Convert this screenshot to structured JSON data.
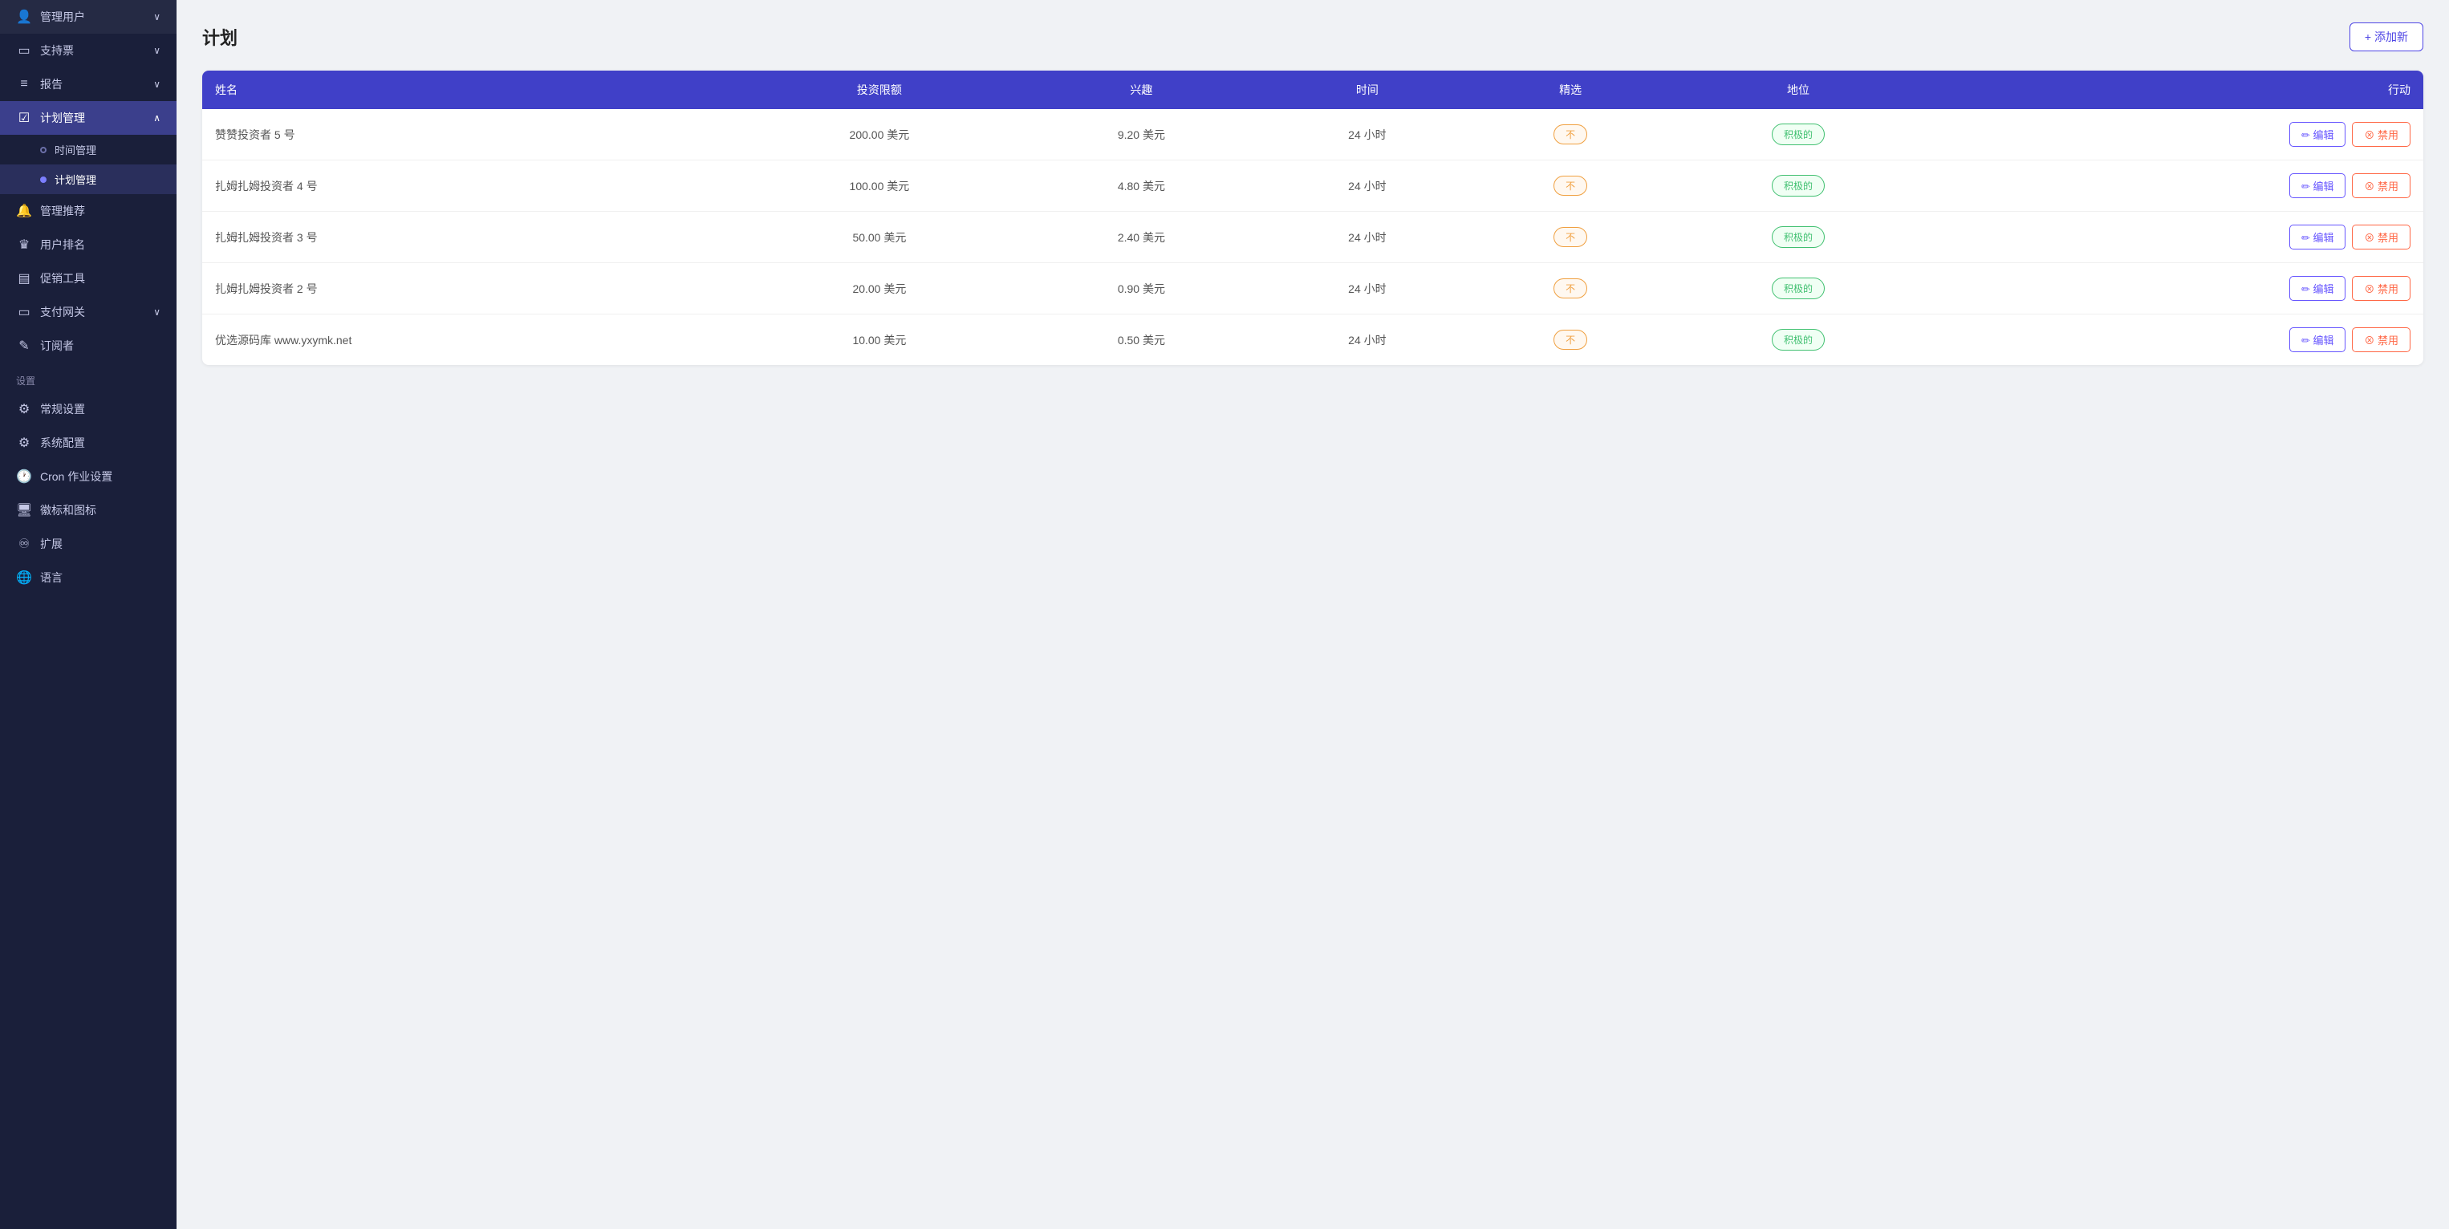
{
  "sidebar": {
    "items": [
      {
        "id": "manage-users",
        "label": "管理用户",
        "icon": "👤",
        "hasArrow": true,
        "active": false
      },
      {
        "id": "support-tickets",
        "label": "支持票",
        "icon": "🎫",
        "hasArrow": true,
        "active": false
      },
      {
        "id": "reports",
        "label": "报告",
        "icon": "📊",
        "hasArrow": true,
        "active": false
      },
      {
        "id": "plan-management",
        "label": "计划管理",
        "icon": "📋",
        "hasArrow": true,
        "active": true,
        "subItems": [
          {
            "id": "time-management",
            "label": "时间管理",
            "active": false
          },
          {
            "id": "plan-management-sub",
            "label": "计划管理",
            "active": true
          }
        ]
      },
      {
        "id": "manage-referrals",
        "label": "管理推荐",
        "icon": "🔔",
        "hasArrow": false,
        "active": false
      },
      {
        "id": "user-ranking",
        "label": "用户排名",
        "icon": "🏅",
        "hasArrow": false,
        "active": false
      },
      {
        "id": "promo-tools",
        "label": "促销工具",
        "icon": "🛍",
        "hasArrow": false,
        "active": false
      },
      {
        "id": "payment-gateway",
        "label": "支付网关",
        "icon": "💳",
        "hasArrow": true,
        "active": false
      },
      {
        "id": "subscribers",
        "label": "订阅者",
        "icon": "📝",
        "hasArrow": false,
        "active": false
      }
    ],
    "settings_label": "设置",
    "settings_items": [
      {
        "id": "general-settings",
        "label": "常规设置",
        "icon": "⚙️"
      },
      {
        "id": "system-config",
        "label": "系统配置",
        "icon": "🔧"
      },
      {
        "id": "cron-settings",
        "label": "Cron 作业设置",
        "icon": "🕐"
      },
      {
        "id": "logo-icons",
        "label": "徽标和图标",
        "icon": "🖥"
      },
      {
        "id": "extensions",
        "label": "扩展",
        "icon": "🔗"
      },
      {
        "id": "language",
        "label": "语言",
        "icon": "🌐"
      }
    ]
  },
  "page": {
    "title": "计划",
    "add_button": "+ 添加新"
  },
  "table": {
    "headers": [
      {
        "id": "name",
        "label": "姓名"
      },
      {
        "id": "investment-limit",
        "label": "投资限额"
      },
      {
        "id": "interest",
        "label": "兴趣"
      },
      {
        "id": "time",
        "label": "时间"
      },
      {
        "id": "featured",
        "label": "精选"
      },
      {
        "id": "status",
        "label": "地位"
      },
      {
        "id": "actions",
        "label": "行动"
      }
    ],
    "rows": [
      {
        "id": 1,
        "name": "赞赞投资者 5 号",
        "investment_limit": "200.00 美元",
        "interest": "9.20 美元",
        "time": "24 小时",
        "featured": "不",
        "status": "积极的",
        "edit_label": "编辑",
        "disable_label": "禁用"
      },
      {
        "id": 2,
        "name": "扎姆扎姆投资者 4 号",
        "investment_limit": "100.00 美元",
        "interest": "4.80 美元",
        "time": "24 小时",
        "featured": "不",
        "status": "积极的",
        "edit_label": "编辑",
        "disable_label": "禁用"
      },
      {
        "id": 3,
        "name": "扎姆扎姆投资者 3 号",
        "investment_limit": "50.00 美元",
        "interest": "2.40 美元",
        "time": "24 小时",
        "featured": "不",
        "status": "积极的",
        "edit_label": "编辑",
        "disable_label": "禁用"
      },
      {
        "id": 4,
        "name": "扎姆扎姆投资者 2 号",
        "investment_limit": "20.00 美元",
        "interest": "0.90 美元",
        "time": "24 小时",
        "featured": "不",
        "status": "积极的",
        "edit_label": "编辑",
        "disable_label": "禁用"
      },
      {
        "id": 5,
        "name": "优选源码库 www.yxymk.net",
        "investment_limit": "10.00 美元",
        "interest": "0.50 美元",
        "time": "24 小时",
        "featured": "不",
        "status": "积极的",
        "edit_label": "编辑",
        "disable_label": "禁用"
      }
    ]
  }
}
